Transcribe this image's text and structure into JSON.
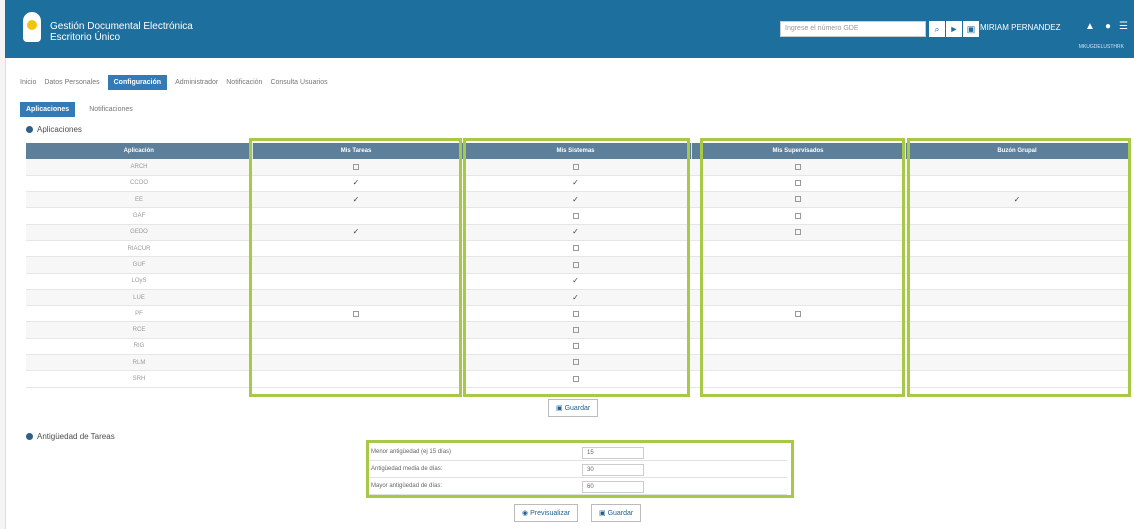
{
  "header": {
    "title": "Gestión Documental Electrónica",
    "subtitle": "Escritorio Único",
    "search_placeholder": "Ingrese el número GDE",
    "user_name": "MIRIAM PERNANDEZ",
    "sub_user": "MKUGDELUSTHRK"
  },
  "tabs": [
    "Inicio",
    "Datos Personales",
    "Configuración",
    "Administrador",
    "Notificación",
    "Consulta Usuarios"
  ],
  "subtabs": [
    "Aplicaciones",
    "Notificaciones"
  ],
  "sections": {
    "apps": "Aplicaciones",
    "antiguedad": "Antigüedad de Tareas"
  },
  "table": {
    "headers": [
      "Aplicación",
      "Mis Tareas",
      "Mis Sistemas",
      "Mis Supervisados",
      "Buzón Grupal"
    ],
    "rows": [
      {
        "app": "ARCH",
        "tareas": "check",
        "sistemas": "check",
        "supervisados": "check",
        "buzon": ""
      },
      {
        "app": "CCOO",
        "tareas": "mark",
        "sistemas": "mark",
        "supervisados": "check",
        "buzon": ""
      },
      {
        "app": "EE",
        "tareas": "mark",
        "sistemas": "mark",
        "supervisados": "check",
        "buzon": "mark"
      },
      {
        "app": "GAF",
        "tareas": "",
        "sistemas": "check",
        "supervisados": "check",
        "buzon": ""
      },
      {
        "app": "GEDO",
        "tareas": "mark",
        "sistemas": "mark",
        "supervisados": "check",
        "buzon": ""
      },
      {
        "app": "RIACUR",
        "tareas": "",
        "sistemas": "check",
        "supervisados": "",
        "buzon": ""
      },
      {
        "app": "GUF",
        "tareas": "",
        "sistemas": "check",
        "supervisados": "",
        "buzon": ""
      },
      {
        "app": "LOyS",
        "tareas": "",
        "sistemas": "mark",
        "supervisados": "",
        "buzon": ""
      },
      {
        "app": "LUE",
        "tareas": "",
        "sistemas": "mark",
        "supervisados": "",
        "buzon": ""
      },
      {
        "app": "PF",
        "tareas": "check",
        "sistemas": "check",
        "supervisados": "check",
        "buzon": ""
      },
      {
        "app": "RCE",
        "tareas": "",
        "sistemas": "check",
        "supervisados": "",
        "buzon": ""
      },
      {
        "app": "RIG",
        "tareas": "",
        "sistemas": "check",
        "supervisados": "",
        "buzon": ""
      },
      {
        "app": "RLM",
        "tareas": "",
        "sistemas": "check",
        "supervisados": "",
        "buzon": ""
      },
      {
        "app": "SRH",
        "tareas": "",
        "sistemas": "check",
        "supervisados": "",
        "buzon": ""
      }
    ]
  },
  "buttons": {
    "save": "Guardar",
    "preview": "Previsualizar"
  },
  "antiguedad": [
    {
      "label": "Menor antigüedad (ej 15 días)",
      "value": "15"
    },
    {
      "label": "Antigüedad media de días:",
      "value": "30"
    },
    {
      "label": "Mayor antigüedad de días:",
      "value": "60"
    }
  ],
  "colors": {
    "header": "#1d6f9d",
    "tab_active": "#337ab7",
    "table_header": "#5d7f99",
    "highlight": "#a8c947"
  }
}
